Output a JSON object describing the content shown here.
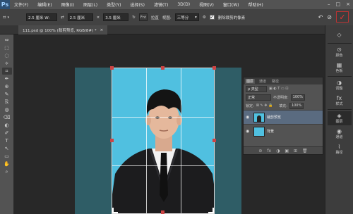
{
  "app": {
    "logo": "Ps"
  },
  "menubar": {
    "items": [
      "文件(F)",
      "编辑(E)",
      "图像(I)",
      "图层(L)",
      "类型(Y)",
      "选择(S)",
      "滤镜(T)",
      "3D(D)",
      "视图(V)",
      "窗口(W)",
      "帮助(H)"
    ],
    "window_controls": [
      "–",
      "□",
      "×"
    ]
  },
  "options": {
    "width": "2.5 厘米 W:",
    "swap": "⇄",
    "height": "2.5 厘米",
    "cm_field": "3.5 厘米",
    "front_btn": "Fnt",
    "clear": "拉直",
    "view_label": "视图:",
    "view_value": "三等分",
    "delete_label": "删除裁剪的像素",
    "delete_checked": "✓",
    "commit": "✓"
  },
  "document": {
    "tab_title": "111.psd @ 100% (裁剪预览, RGB/8#) *",
    "close": "×"
  },
  "tools": [
    "⇔",
    "⬚",
    "◌",
    "⟡",
    "⌗",
    "✒",
    "⊕",
    "✎",
    "⎘",
    "◍",
    "⌫",
    "◐",
    "✐",
    "T",
    "↖",
    "▭",
    "✋",
    "⌕"
  ],
  "dock": {
    "buttons": [
      {
        "icon": "◇",
        "label": ""
      },
      {
        "icon": "⊙",
        "label": "颜色"
      },
      {
        "icon": "▦",
        "label": "色板"
      },
      {
        "icon": "◑",
        "label": "调整"
      },
      {
        "icon": "fx",
        "label": "样式"
      },
      {
        "icon": "◈",
        "label": "图层"
      },
      {
        "icon": "◉",
        "label": "通道"
      },
      {
        "icon": "⌇",
        "label": "路径"
      }
    ]
  },
  "layers_panel": {
    "tabs": [
      "图层",
      "通道",
      "路径"
    ],
    "kind": "ρ 类型",
    "blend_mode": "正常",
    "opacity_label": "不透明度:",
    "opacity_value": "100%",
    "lock_label": "锁定:",
    "fill_label": "填充:",
    "fill_value": "100%",
    "layers": [
      {
        "name": "裁剪预览",
        "visible": "◉"
      },
      {
        "name": "背景",
        "visible": "◉"
      }
    ],
    "bottom_icons": [
      "⊘",
      "fx",
      "◑",
      "▣",
      "⊞",
      "🗑"
    ]
  },
  "colors": {
    "accent_commit": "#e33333",
    "canvas_bg": "#50c0e0",
    "selected_layer": "#5a6b80"
  }
}
